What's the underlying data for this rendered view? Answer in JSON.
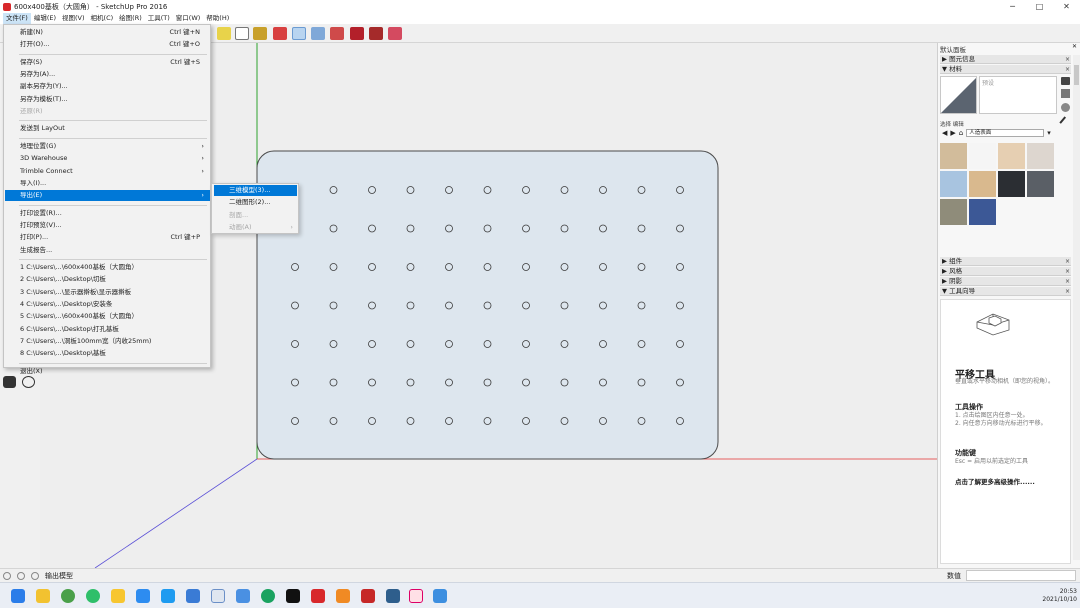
{
  "window": {
    "title": "600x400基板（大圆角） - SketchUp Pro 2016",
    "minimize": "─",
    "maximize": "□",
    "close": "✕"
  },
  "menubar": [
    "文件(F)",
    "编辑(E)",
    "视图(V)",
    "相机(C)",
    "绘图(R)",
    "工具(T)",
    "窗口(W)",
    "帮助(H)"
  ],
  "file_menu": [
    {
      "label": "新建(N)",
      "shortcut": "Ctrl 键+N"
    },
    {
      "label": "打开(O)...",
      "shortcut": "Ctrl 键+O"
    },
    {
      "sep": true
    },
    {
      "label": "保存(S)",
      "shortcut": "Ctrl 键+S"
    },
    {
      "label": "另存为(A)..."
    },
    {
      "label": "副本另存为(Y)..."
    },
    {
      "label": "另存为模板(T)..."
    },
    {
      "label": "还原(R)",
      "disabled": true
    },
    {
      "sep": true
    },
    {
      "label": "发送到 LayOut"
    },
    {
      "sep": true
    },
    {
      "label": "地理位置(G)",
      "arrow": true
    },
    {
      "label": "3D Warehouse",
      "arrow": true
    },
    {
      "label": "Trimble Connect",
      "arrow": true
    },
    {
      "label": "导入(I)..."
    },
    {
      "label": "导出(E)",
      "arrow": true,
      "highlight": true
    },
    {
      "sep": true
    },
    {
      "label": "打印设置(R)..."
    },
    {
      "label": "打印预览(V)..."
    },
    {
      "label": "打印(P)...",
      "shortcut": "Ctrl 键+P"
    },
    {
      "label": "生成报告..."
    },
    {
      "sep": true
    },
    {
      "label": "1 C:\\Users\\...\\600x400基板（大圆角）"
    },
    {
      "label": "2 C:\\Users\\...\\Desktop\\切板"
    },
    {
      "label": "3 C:\\Users\\...\\显示器擀板\\显示器擀板"
    },
    {
      "label": "4 C:\\Users\\...\\Desktop\\安装条"
    },
    {
      "label": "5 C:\\Users\\...\\600x400基板（大圆角）"
    },
    {
      "label": "6 C:\\Users\\...\\Desktop\\打孔基板"
    },
    {
      "label": "7 C:\\Users\\...\\洞板100mm宽（内收25mm)"
    },
    {
      "label": "8 C:\\Users\\...\\Desktop\\基板"
    },
    {
      "sep": true
    },
    {
      "label": "退出(X)"
    }
  ],
  "export_submenu": [
    {
      "label": "三维模型(3)...",
      "highlight": true
    },
    {
      "label": "二维图形(2)..."
    },
    {
      "label": "剖面...",
      "disabled": true
    },
    {
      "label": "动画(A)",
      "disabled": true,
      "arrow": true
    }
  ],
  "tray": {
    "title": "默认面板",
    "close": "✕",
    "sections_top": [
      {
        "label": "▶ 图元信息",
        "close": "×"
      },
      {
        "label": "▼ 材料",
        "close": "×"
      }
    ],
    "material_placeholder": "预设",
    "mini_tabs": "选择  编辑",
    "select_value": "人造表面",
    "swatch_colors": [
      "#d2bc9b",
      "#f5f5f5",
      "#e6cfb2",
      "#ddd6cf",
      "#a8c4e0",
      "#d9b98e",
      "#2b2e33",
      "#5a5f66",
      "#8f8c7a",
      "#3c5896"
    ],
    "sections_bottom": [
      {
        "label": "▶ 组件",
        "close": "×"
      },
      {
        "label": "▶ 风格",
        "close": "×"
      },
      {
        "label": "▶ 阴影",
        "close": "×"
      },
      {
        "label": "▼ 工具向导",
        "close": "×"
      }
    ],
    "guide": {
      "title": "平移工具",
      "subtitle": "垂直或水平移动相机（即您的视角）。",
      "ops_heading": "工具操作",
      "ops_text": "1.   点击绘图区内任意一处。\n2.   向任意方向移动光标进行平移。",
      "keys_heading": "功能键",
      "keys_text": "Esc = 启用以前选定的工具",
      "more": "点击了解更多高级操作......"
    }
  },
  "status": {
    "text": "输出模型",
    "measure_label": "数值"
  },
  "taskbar": {
    "time": "20:53",
    "date": "2021/10/10"
  },
  "colors": {
    "board_fill": "#dde6ee",
    "board_stroke": "#4a4a4a",
    "axis_red": "#e23030",
    "axis_green": "#2fa12f",
    "axis_blue": "#5a4fd6",
    "highlight": "#0078d7"
  }
}
